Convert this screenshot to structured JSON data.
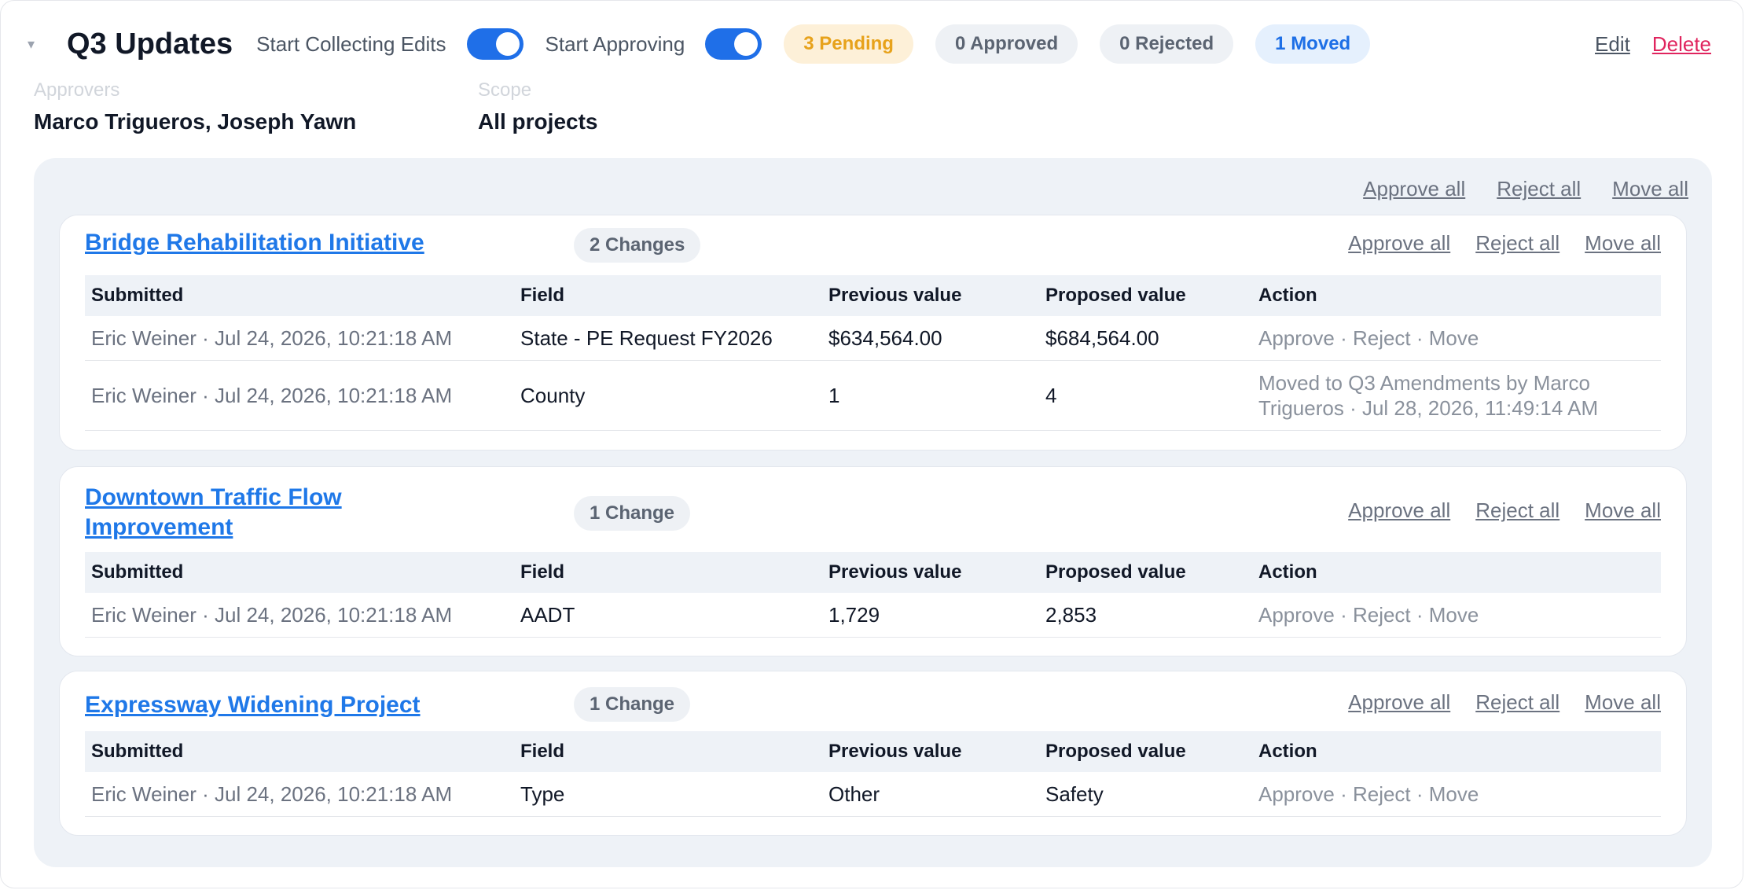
{
  "header": {
    "title": "Q3 Updates",
    "toggle_collect_label": "Start Collecting Edits",
    "toggle_approve_label": "Start Approving",
    "badge_pending": "3 Pending",
    "badge_approved": "0 Approved",
    "badge_rejected": "0 Rejected",
    "badge_moved": "1 Moved",
    "edit_label": "Edit",
    "delete_label": "Delete"
  },
  "meta": {
    "approvers_label": "Approvers",
    "approvers_value": "Marco Trigueros, Joseph Yawn",
    "scope_label": "Scope",
    "scope_value": "All projects"
  },
  "bulk": {
    "approve_all": "Approve all",
    "reject_all": "Reject all",
    "move_all": "Move all"
  },
  "columns": {
    "submitted": "Submitted",
    "field": "Field",
    "previous": "Previous value",
    "proposed": "Proposed value",
    "action": "Action"
  },
  "row_actions": {
    "approve": "Approve",
    "reject": "Reject",
    "move": "Move",
    "sep": " · "
  },
  "projects": [
    {
      "title": "Bridge Rehabilitation Initiative",
      "changes": "2 Changes",
      "rows": [
        {
          "submitted": "Eric Weiner · Jul 24, 2026, 10:21:18 AM",
          "field": "State - PE Request FY2026",
          "previous": "$634,564.00",
          "proposed": "$684,564.00"
        },
        {
          "submitted": "Eric Weiner · Jul 24, 2026, 10:21:18 AM",
          "field": "County",
          "previous": "1",
          "proposed": "4",
          "status": "Moved to Q3 Amendments by Marco Trigueros · Jul 28, 2026, 11:49:14 AM"
        }
      ]
    },
    {
      "title": "Downtown Traffic Flow Improvement",
      "changes": "1 Change",
      "rows": [
        {
          "submitted": "Eric Weiner · Jul 24, 2026, 10:21:18 AM",
          "field": "AADT",
          "previous": "1,729",
          "proposed": "2,853"
        }
      ]
    },
    {
      "title": "Expressway Widening Project",
      "changes": "1 Change",
      "rows": [
        {
          "submitted": "Eric Weiner · Jul 24, 2026, 10:21:18 AM",
          "field": "Type",
          "previous": "Other",
          "proposed": "Safety"
        }
      ]
    }
  ],
  "colors": {
    "accent": "#1f6fe8",
    "pending": "#e7a21b",
    "delete": "#e0245e",
    "link": "#1f78e8"
  }
}
